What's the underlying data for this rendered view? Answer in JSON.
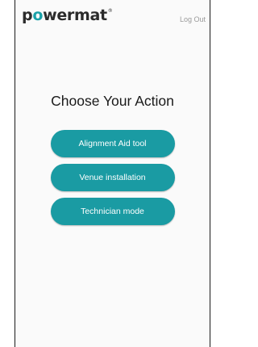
{
  "header": {
    "logo_prefix": "p",
    "logo_accent": "o",
    "logo_suffix": "wermat",
    "logo_tm": "®",
    "logout_label": "Log Out"
  },
  "main": {
    "title": "Choose Your Action",
    "actions": [
      {
        "label": "Alignment Aid tool"
      },
      {
        "label": "Venue installation"
      },
      {
        "label": "Technician mode"
      }
    ]
  },
  "colors": {
    "brand_teal": "#1a9ba3",
    "logo_accent": "#1aa1a8"
  }
}
